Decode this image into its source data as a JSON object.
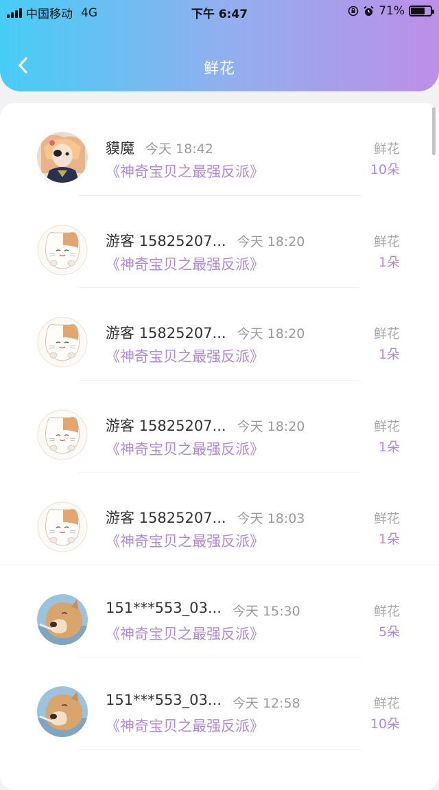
{
  "status_bar": {
    "carrier": "中国移动",
    "network": "4G",
    "time": "下午 6:47",
    "battery_percent": "71%",
    "battery_level": 0.71
  },
  "nav": {
    "back_icon": "chevron-left-icon",
    "title": "鲜花"
  },
  "colors": {
    "header_gradient_start": "#46cdf6",
    "header_gradient_end": "#bc8fe8",
    "accent_purple": "#b088dc"
  },
  "flower_label": "鲜花",
  "records": [
    {
      "name": "貘魔",
      "time": "今天 18:42",
      "book": "《神奇宝贝之最强反派》",
      "label": "鲜花",
      "count": "10朵",
      "avatar": "anime-avatar"
    },
    {
      "name": "游客 15825207...",
      "time": "今天 18:20",
      "book": "《神奇宝贝之最强反派》",
      "label": "鲜花",
      "count": "1朵",
      "avatar": "cat-avatar"
    },
    {
      "name": "游客 15825207...",
      "time": "今天 18:20",
      "book": "《神奇宝贝之最强反派》",
      "label": "鲜花",
      "count": "1朵",
      "avatar": "cat-avatar"
    },
    {
      "name": "游客 15825207...",
      "time": "今天 18:20",
      "book": "《神奇宝贝之最强反派》",
      "label": "鲜花",
      "count": "1朵",
      "avatar": "cat-avatar"
    },
    {
      "name": "游客 15825207...",
      "time": "今天 18:03",
      "book": "《神奇宝贝之最强反派》",
      "label": "鲜花",
      "count": "1朵",
      "avatar": "cat-avatar"
    },
    {
      "name": "151***553_03...",
      "time": "今天 15:30",
      "book": "《神奇宝贝之最强反派》",
      "label": "鲜花",
      "count": "5朵",
      "avatar": "dog-avatar"
    },
    {
      "name": "151***553_03...",
      "time": "今天 12:58",
      "book": "《神奇宝贝之最强反派》",
      "label": "鲜花",
      "count": "10朵",
      "avatar": "dog-avatar"
    }
  ]
}
